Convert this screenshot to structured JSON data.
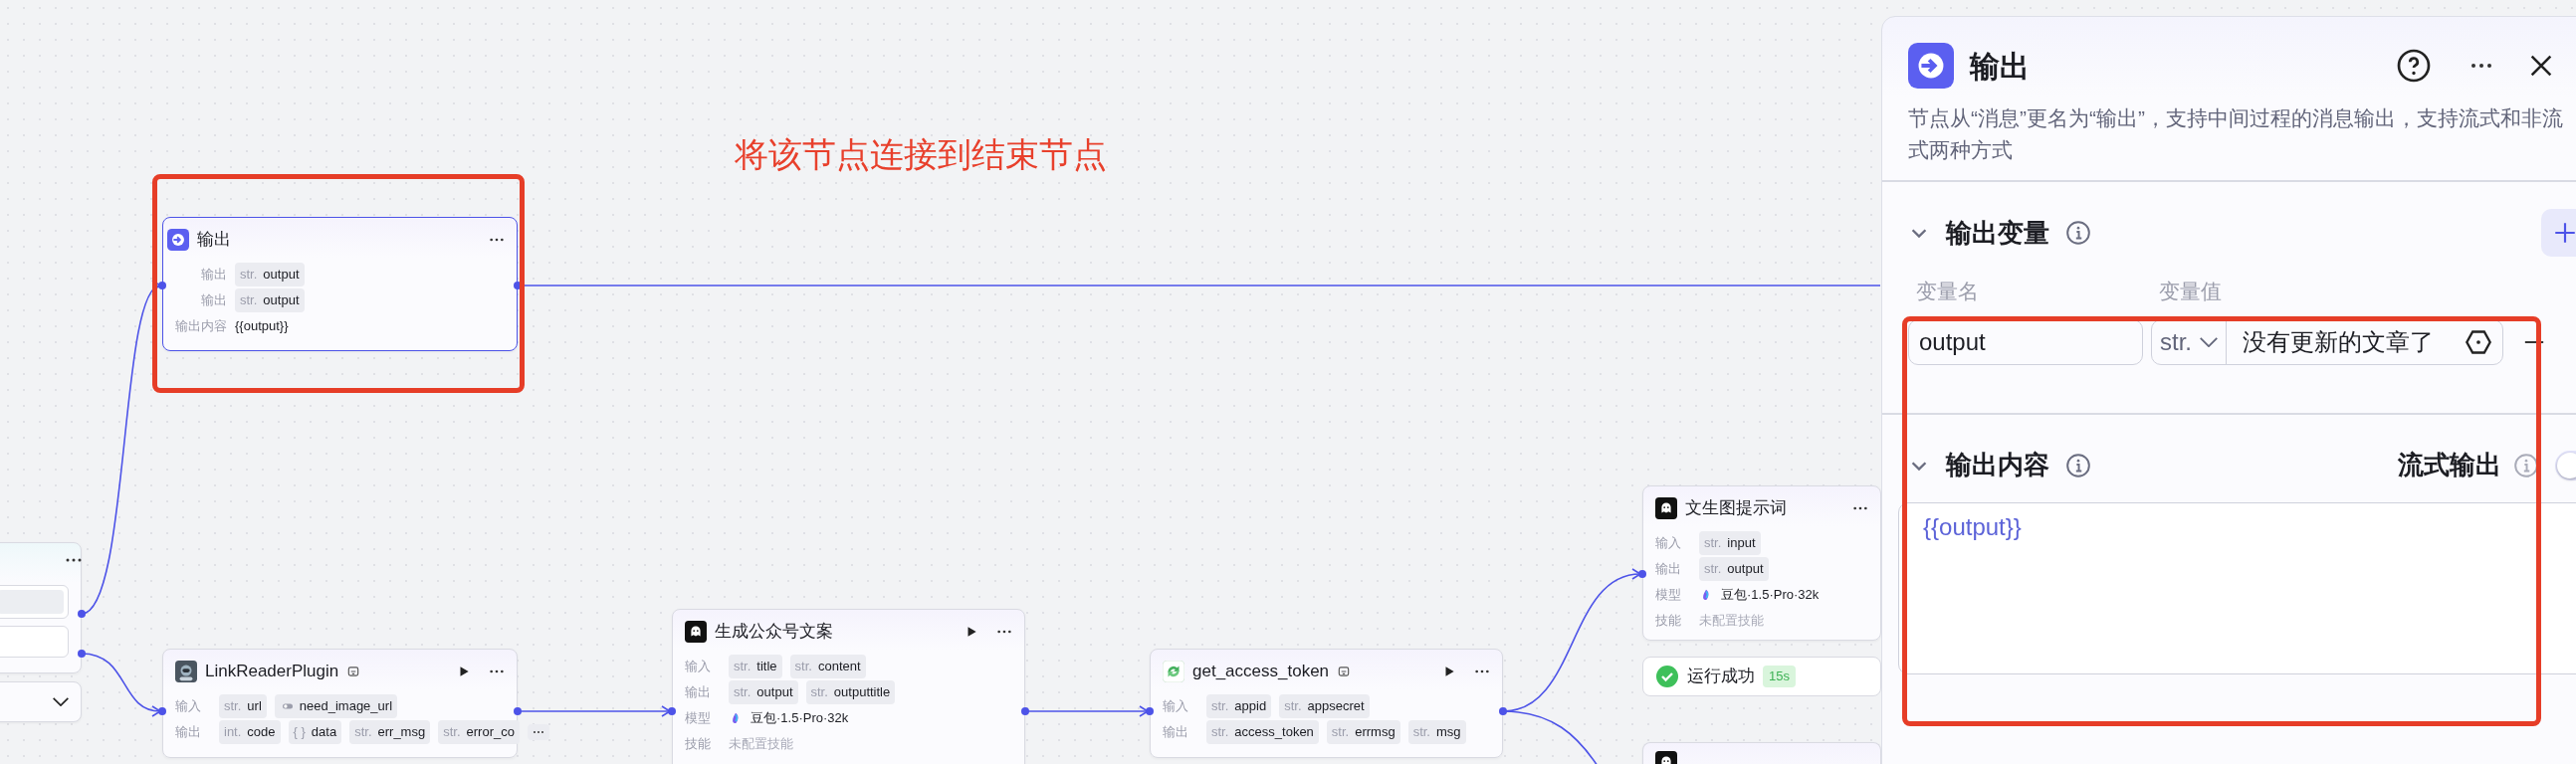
{
  "annotation": {
    "text": "将该节点连接到结束节点"
  },
  "nodes": [
    {
      "kind": "output",
      "title": "输出",
      "selected": true,
      "rows": [
        {
          "kind": "tags",
          "label": "输出",
          "tags": [
            {
              "kind": "typed",
              "type": "str.",
              "name": "output"
            }
          ]
        },
        {
          "kind": "tags",
          "label": "输出",
          "tags": [
            {
              "kind": "typed",
              "type": "str.",
              "name": "output"
            }
          ]
        },
        {
          "kind": "text",
          "label": "输出内容",
          "text": "{{output}}"
        }
      ]
    },
    {
      "kind": "partial",
      "selected": false
    },
    {
      "kind": "plugin",
      "title": "LinkReaderPlugin",
      "selected": false,
      "runnable": true,
      "rows": [
        {
          "kind": "tags",
          "label": "输入",
          "tags": [
            {
              "kind": "typed",
              "type": "str.",
              "name": "url"
            },
            {
              "kind": "bool",
              "name": "need_image_url"
            }
          ]
        },
        {
          "kind": "tags",
          "label": "输出",
          "tags": [
            {
              "kind": "typed",
              "type": "int.",
              "name": "code"
            },
            {
              "kind": "typed",
              "type": "{ }",
              "name": "data"
            },
            {
              "kind": "typed",
              "type": "str.",
              "name": "err_msg"
            },
            {
              "kind": "typed",
              "type": "str.",
              "name": "error_co"
            },
            {
              "kind": "more"
            }
          ]
        }
      ]
    },
    {
      "kind": "llm",
      "title": "生成公众号文案",
      "selected": false,
      "runnable": true,
      "rows": [
        {
          "kind": "tags",
          "label": "输入",
          "tags": [
            {
              "kind": "typed",
              "type": "str.",
              "name": "title"
            },
            {
              "kind": "typed",
              "type": "str.",
              "name": "content"
            }
          ]
        },
        {
          "kind": "tags",
          "label": "输出",
          "tags": [
            {
              "kind": "typed",
              "type": "str.",
              "name": "output"
            },
            {
              "kind": "typed",
              "type": "str.",
              "name": "outputtitle"
            }
          ]
        },
        {
          "kind": "model",
          "label": "模型",
          "text": "豆包·1.5·Pro·32k"
        },
        {
          "kind": "hint",
          "label": "技能",
          "text": "未配置技能"
        }
      ]
    },
    {
      "kind": "plugin",
      "title": "get_access_token",
      "selected": false,
      "runnable": true,
      "rows": [
        {
          "kind": "tags",
          "label": "输入",
          "tags": [
            {
              "kind": "typed",
              "type": "str.",
              "name": "appid"
            },
            {
              "kind": "typed",
              "type": "str.",
              "name": "appsecret"
            }
          ]
        },
        {
          "kind": "tags",
          "label": "输出",
          "tags": [
            {
              "kind": "typed",
              "type": "str.",
              "name": "access_token"
            },
            {
              "kind": "typed",
              "type": "str.",
              "name": "errmsg"
            },
            {
              "kind": "typed",
              "type": "str.",
              "name": "msg"
            }
          ]
        }
      ]
    },
    {
      "kind": "llm",
      "title": "文生图提示词",
      "selected": false,
      "rows": [
        {
          "kind": "tags",
          "label": "输入",
          "tags": [
            {
              "kind": "typed",
              "type": "str.",
              "name": "input"
            }
          ]
        },
        {
          "kind": "tags",
          "label": "输出",
          "tags": [
            {
              "kind": "typed",
              "type": "str.",
              "name": "output"
            }
          ]
        },
        {
          "kind": "model",
          "label": "模型",
          "text": "豆包·1.5·Pro·32k"
        },
        {
          "kind": "hint",
          "label": "技能",
          "text": "未配置技能"
        }
      ]
    },
    {
      "kind": "status",
      "success": true,
      "text": "运行成功",
      "duration": "15s"
    },
    {
      "kind": "stub",
      "selected": false
    }
  ],
  "panel": {
    "title": "输出",
    "description": "节点从“消息”更名为“输出”，支持中间过程的消息输出，支持流式和非流式两种方式",
    "sections": [
      {
        "kind": "variables",
        "title": "输出变量",
        "expanded": true,
        "columns": [
          "变量名",
          "变量值"
        ],
        "rows": [
          {
            "name": "output",
            "type": "str.",
            "value": "没有更新的文章了"
          }
        ]
      },
      {
        "kind": "content",
        "title": "输出内容",
        "expanded": true,
        "streaming": {
          "label": "流式输出",
          "on": false
        },
        "content": "{{output}}"
      }
    ]
  }
}
